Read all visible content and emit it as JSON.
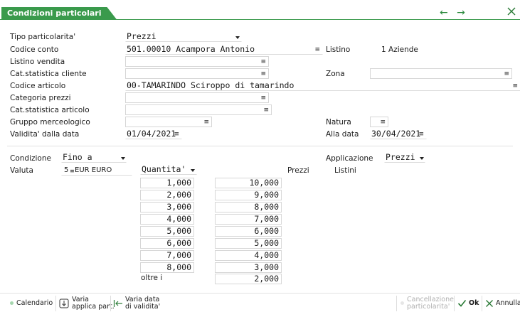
{
  "window": {
    "title": "Condizioni particolari",
    "nav_arrows": "← →"
  },
  "form": {
    "tipo": {
      "label": "Tipo particolarita'",
      "value": "Prezzi"
    },
    "codice_conto": {
      "label": "Codice conto",
      "value": "501.00010 Acampora Antonio"
    },
    "listino": {
      "label": "Listino",
      "value": "1 Aziende"
    },
    "listino_vendita": {
      "label": "Listino vendita",
      "value": ""
    },
    "cat_cliente": {
      "label": "Cat.statistica cliente",
      "value": ""
    },
    "zona": {
      "label": "Zona",
      "value": ""
    },
    "codice_articolo": {
      "label": "Codice articolo",
      "value": "00-TAMARINDO Sciroppo di tamarindo"
    },
    "categoria_prezzi": {
      "label": "Categoria prezzi",
      "value": ""
    },
    "cat_articolo": {
      "label": "Cat.statistica articolo",
      "value": ""
    },
    "gruppo": {
      "label": "Gruppo merceologico",
      "value": ""
    },
    "natura": {
      "label": "Natura",
      "value": ""
    },
    "validita": {
      "label": "Validita' dalla data",
      "value": "01/04/2021"
    },
    "alla_data": {
      "label": "Alla data",
      "value": "30/04/2021"
    },
    "condizione": {
      "label": "Condizione",
      "value": "Fino a"
    },
    "applicazione": {
      "label": "Applicazione",
      "value": "Prezzi"
    },
    "valuta": {
      "label": "Valuta",
      "code": "5",
      "value": "EUR EURO"
    },
    "quantita_select": "Quantita'",
    "prezzi_header": "Prezzi",
    "listini_header": "Listini",
    "oltre_label": "oltre i"
  },
  "rows": [
    {
      "qty": "1,000",
      "price": "10,000"
    },
    {
      "qty": "2,000",
      "price": "9,000"
    },
    {
      "qty": "3,000",
      "price": "8,000"
    },
    {
      "qty": "4,000",
      "price": "7,000"
    },
    {
      "qty": "5,000",
      "price": "6,000"
    },
    {
      "qty": "6,000",
      "price": "5,000"
    },
    {
      "qty": "7,000",
      "price": "4,000"
    },
    {
      "qty": "8,000",
      "price": "3,000"
    }
  ],
  "oltre_price": "2,000",
  "toolbar": {
    "calendario": "Calendario",
    "varia_applica_1": "Varia",
    "varia_applica_2": "applica part.",
    "varia_data_1": "Varia data",
    "varia_data_2": "di validita'",
    "cancellazione_1": "Cancellazione",
    "cancellazione_2": "particolarita'",
    "ok": "Ok",
    "annulla": "Annulla"
  },
  "colors": {
    "accent": "#3a9a4c"
  }
}
